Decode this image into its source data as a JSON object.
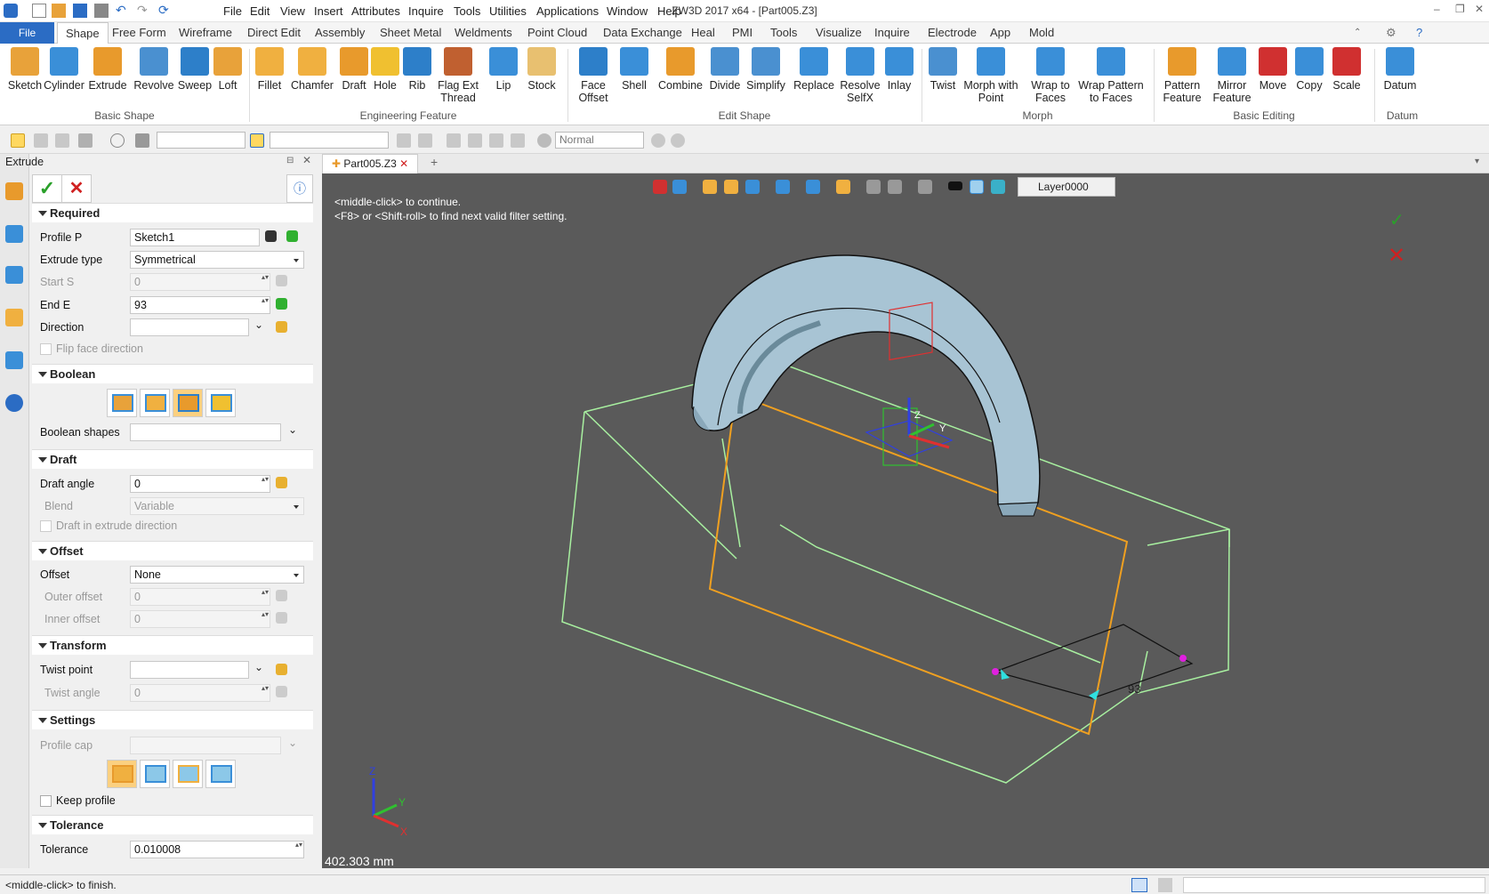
{
  "app": {
    "title": "ZW3D 2017  x64 - [Part005.Z3]"
  },
  "menu": [
    "File",
    "Edit",
    "View",
    "Insert",
    "Attributes",
    "Inquire",
    "Tools",
    "Utilities",
    "Applications",
    "Window",
    "Help"
  ],
  "tabs": [
    "File",
    "Shape",
    "Free Form",
    "Wireframe",
    "Direct Edit",
    "Assembly",
    "Sheet Metal",
    "Weldments",
    "Point Cloud",
    "Data Exchange",
    "Heal",
    "PMI",
    "Tools",
    "Visualize",
    "Inquire",
    "Electrode",
    "App",
    "Mold"
  ],
  "ribbon": {
    "buttons": [
      {
        "label": "Sketch",
        "color": "#e8a23a"
      },
      {
        "label": "Cylinder",
        "color": "#3a8fd8"
      },
      {
        "label": "Extrude",
        "color": "#e89a2c"
      },
      {
        "label": "Revolve",
        "color": "#4a90d0"
      },
      {
        "label": "Sweep",
        "color": "#2d7fc9"
      },
      {
        "label": "Loft",
        "color": "#e8a23a"
      },
      {
        "label": "Fillet",
        "color": "#f0b040"
      },
      {
        "label": "Chamfer",
        "color": "#f0b040"
      },
      {
        "label": "Draft",
        "color": "#e89a2c"
      },
      {
        "label": "Hole",
        "color": "#f0c030"
      },
      {
        "label": "Rib",
        "color": "#2d7fc9"
      },
      {
        "label": "Flag Ext\nThread",
        "color": "#c06030"
      },
      {
        "label": "Lip",
        "color": "#3a8fd8"
      },
      {
        "label": "Stock",
        "color": "#e8c070"
      },
      {
        "label": "Face\nOffset",
        "color": "#2d7fc9"
      },
      {
        "label": "Shell",
        "color": "#3a8fd8"
      },
      {
        "label": "Combine",
        "color": "#e89a2c"
      },
      {
        "label": "Divide",
        "color": "#4a90d0"
      },
      {
        "label": "Simplify",
        "color": "#4a90d0"
      },
      {
        "label": "Replace",
        "color": "#3a8fd8"
      },
      {
        "label": "Resolve\nSelfX",
        "color": "#3a8fd8"
      },
      {
        "label": "Inlay",
        "color": "#3a8fd8"
      },
      {
        "label": "Twist",
        "color": "#4a90d0"
      },
      {
        "label": "Morph with\nPoint",
        "color": "#3a8fd8"
      },
      {
        "label": "Wrap to\nFaces",
        "color": "#3a8fd8"
      },
      {
        "label": "Wrap Pattern\nto Faces",
        "color": "#3a8fd8"
      },
      {
        "label": "Pattern\nFeature",
        "color": "#e89a2c"
      },
      {
        "label": "Mirror\nFeature",
        "color": "#3a8fd8"
      },
      {
        "label": "Move",
        "color": "#d03030"
      },
      {
        "label": "Copy",
        "color": "#3a8fd8"
      },
      {
        "label": "Scale",
        "color": "#d03030"
      },
      {
        "label": "Datum",
        "color": "#3a8fd8"
      }
    ],
    "groups": [
      "Basic Shape",
      "Engineering Feature",
      "Edit Shape",
      "Morph",
      "Basic Editing",
      "Datum"
    ]
  },
  "toolbar": {
    "filter_value": "",
    "style_value": "Normal"
  },
  "panel": {
    "title": "Extrude",
    "sections": {
      "required": "Required",
      "boolean": "Boolean",
      "draft": "Draft",
      "offset": "Offset",
      "transform": "Transform",
      "settings": "Settings",
      "tolerance": "Tolerance"
    },
    "profile_label": "Profile P",
    "profile_value": "Sketch1",
    "extrude_type_label": "Extrude type",
    "extrude_type_value": "Symmetrical",
    "start_label": "Start S",
    "start_value": "0",
    "end_label": "End E",
    "end_value": "93",
    "direction_label": "Direction",
    "direction_value": "",
    "flip_label": "Flip face direction",
    "boolean_shapes_label": "Boolean shapes",
    "draft_angle_label": "Draft angle",
    "draft_angle_value": "0",
    "blend_label": "Blend",
    "blend_value": "Variable",
    "draft_dir_label": "Draft in extrude direction",
    "offset_label": "Offset",
    "offset_value": "None",
    "outer_offset_label": "Outer offset",
    "outer_offset_value": "0",
    "inner_offset_label": "Inner offset",
    "inner_offset_value": "0",
    "twist_point_label": "Twist point",
    "twist_angle_label": "Twist angle",
    "twist_angle_value": "0",
    "profile_cap_label": "Profile cap",
    "keep_profile_label": "Keep profile",
    "tolerance_label": "Tolerance",
    "tolerance_value": "0.010008"
  },
  "doc": {
    "tab": "Part005.Z3",
    "layer": "Layer0000"
  },
  "viewport": {
    "hint1": "<middle-click> to continue.",
    "hint2": "<F8> or <Shift-roll> to find next valid filter setting.",
    "measure": "402.303 mm",
    "dim_label": "93",
    "axis_z": "Z",
    "axis_y": "Y",
    "axis_x": "X"
  },
  "status": {
    "text": "<middle-click> to finish."
  }
}
